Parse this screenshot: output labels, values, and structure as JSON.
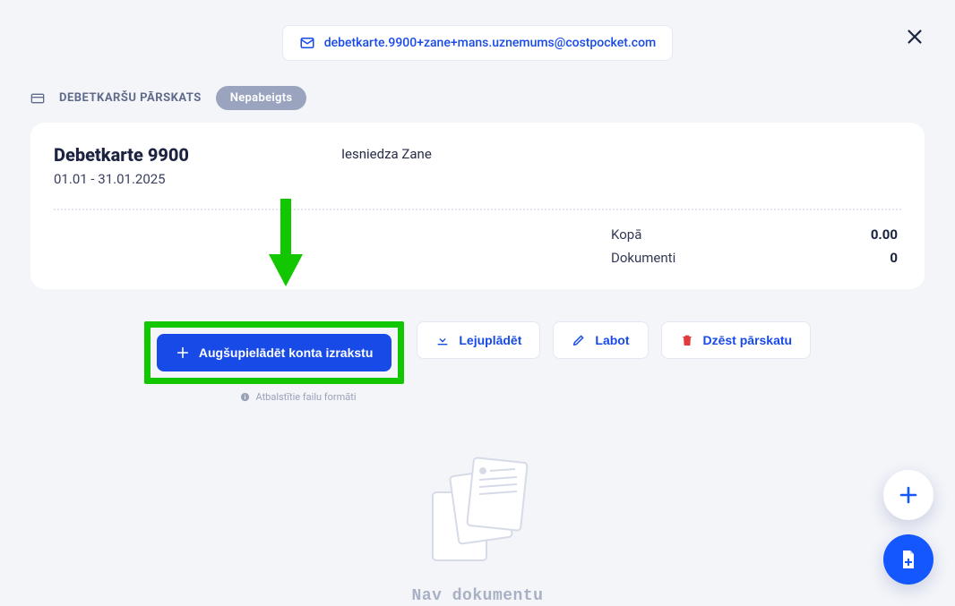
{
  "header": {
    "email": "debetkarte.9900+zane+mans.uznemums@costpocket.com"
  },
  "breadcrumb": {
    "title": "DEBETKARŠU PĀRSKATS",
    "status": "Nepabeigts"
  },
  "card": {
    "title": "Debetkarte 9900",
    "date_range": "01.01 - 31.01.2025",
    "submitted_by": "Iesniedza Zane",
    "total_label": "Kopā",
    "total_value": "0.00",
    "docs_label": "Dokumenti",
    "docs_value": "0"
  },
  "actions": {
    "upload": "Augšupielādēt konta izrakstu",
    "download": "Lejuplādēt",
    "edit": "Labot",
    "delete": "Dzēst pārskatu",
    "supported_formats": "Atbalstītie failu formāti"
  },
  "empty": {
    "message": "Nav dokumentu"
  }
}
